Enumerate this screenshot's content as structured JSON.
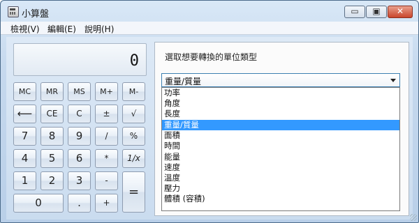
{
  "window": {
    "title": "小算盤",
    "controls": {
      "minimize": "▭",
      "maximize": "▣",
      "close": "✕"
    }
  },
  "menubar": {
    "items": [
      "檢視(V)",
      "編輯(E)",
      "說明(H)"
    ]
  },
  "calculator": {
    "display_value": "0",
    "keys": {
      "mc": "MC",
      "mr": "MR",
      "ms": "MS",
      "mplus": "M+",
      "mminus": "M-",
      "backspace": "⟵",
      "ce": "CE",
      "c": "C",
      "plusminus": "±",
      "sqrt": "√",
      "seven": "7",
      "eight": "8",
      "nine": "9",
      "divide": "/",
      "percent": "%",
      "four": "4",
      "five": "5",
      "six": "6",
      "multiply": "*",
      "reciprocal": "1/x",
      "one": "1",
      "two": "2",
      "three": "3",
      "subtract": "-",
      "equals": "=",
      "zero": "0",
      "decimal": ".",
      "add": "+"
    }
  },
  "converter": {
    "label": "選取想要轉換的單位類型",
    "selected": "重量/質量",
    "options": [
      "功率",
      "角度",
      "長度",
      "重量/質量",
      "面積",
      "時間",
      "能量",
      "速度",
      "溫度",
      "壓力",
      "體積 (容積)"
    ]
  },
  "colors": {
    "selection": "#3399ff",
    "close_button": "#c9452c",
    "window_frame": "#c6d9ee"
  }
}
